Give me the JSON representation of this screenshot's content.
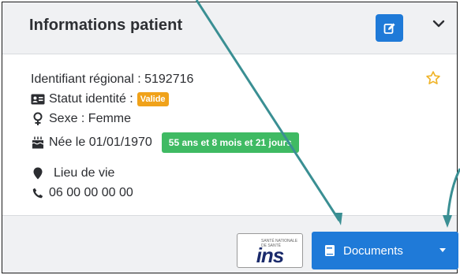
{
  "header": {
    "title": "Informations patient"
  },
  "patient": {
    "identifier_label": "Identifiant régional : 5192716",
    "identity_status_label": "Statut identité :",
    "identity_status_badge": "Valide",
    "sex_label": "Sexe : Femme",
    "birth_label": "Née le 01/01/1970",
    "age_badge": "55 ans et 8 mois et 21 jours",
    "residence_label": "Lieu de vie",
    "phone_label": "06 00 00 00 00"
  },
  "footer": {
    "ins_logo_text": "ins",
    "ins_logo_small": "SANTÉ NATIONALE DE SANTÉ",
    "documents_label": "Documents"
  },
  "colors": {
    "primary": "#1f7ad8",
    "warning": "#f0a21a",
    "success": "#3fba63",
    "header_bg": "#f0f1f3",
    "arrow": "#3a8f93",
    "star": "#f0b429"
  },
  "icons": {
    "edit": "pencil-square-icon",
    "collapse": "chevron-down-icon",
    "favorite": "star-outline-icon",
    "identity": "id-card-icon",
    "sex": "female-symbol-icon",
    "birth": "birthday-cake-icon",
    "residence": "map-marker-icon",
    "phone": "phone-icon",
    "documents": "book-icon",
    "dropdown": "caret-down-icon"
  }
}
